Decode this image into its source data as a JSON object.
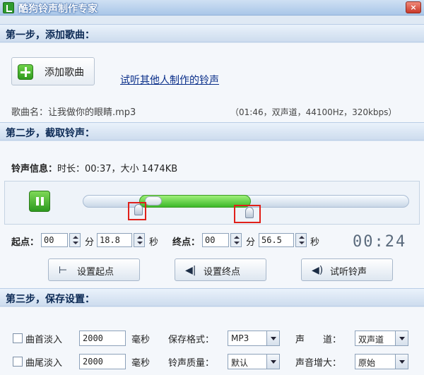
{
  "window": {
    "title": "酷狗铃声制作专家",
    "close_label": "×"
  },
  "step1": {
    "header": "第一步，添加歌曲：",
    "add_button": "添加歌曲",
    "link": "试听其他人制作的铃声",
    "song_name": "歌曲名：让我做你的眼睛.mp3",
    "song_info": "（01:46，双声道，44100Hz，320kbps）"
  },
  "step2": {
    "header": "第二步，截取铃声：",
    "info_label": "铃声信息：",
    "info_value": "时长：00:37，大小 1474KB",
    "selection": {
      "start_fraction": 0.18,
      "end_fraction": 0.53
    },
    "start_label": "起点：",
    "start_min": "00",
    "min_unit": "分",
    "start_sec": "18.8",
    "sec_unit": "秒",
    "end_label": "终点：",
    "end_min": "00",
    "end_sec": "56.5",
    "timer": "00:24",
    "btn_set_start": "设置起点",
    "btn_set_end": "设置终点",
    "btn_preview": "试听铃声"
  },
  "step3": {
    "header": "第三步，保存设置：",
    "fade_in_label": "曲首淡入",
    "fade_in_value": "2000",
    "fade_out_label": "曲尾淡入",
    "fade_out_value": "2000",
    "ms_unit": "毫秒",
    "format_label": "保存格式：",
    "format_value": "MP3",
    "quality_label": "铃声质量：",
    "quality_value": "默认",
    "channel_label": "声　　道：",
    "channel_value": "双声道",
    "boost_label": "声音增大：",
    "boost_value": "原始"
  },
  "colors": {
    "accent_green": "#3cb82a",
    "highlight_red": "#e0201a",
    "header_text": "#0c2a55"
  },
  "icons": [
    "app-icon",
    "close-icon",
    "plus-icon",
    "pause-icon",
    "set-start-icon",
    "set-end-icon",
    "speaker-icon"
  ]
}
